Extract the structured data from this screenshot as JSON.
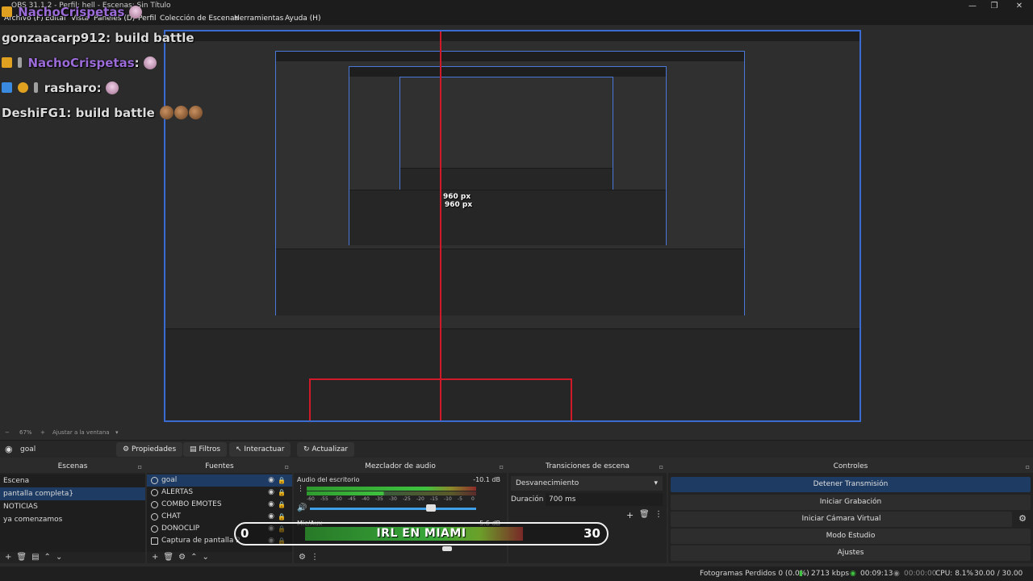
{
  "window": {
    "title": "OBS 31.1.2 - Perfil: hell - Escenas: Sin Título",
    "minimize_glyph": "—",
    "maximize_glyph": "❐",
    "close_glyph": "✕"
  },
  "menu": {
    "items": [
      "Archivo (F)",
      "Editar",
      "Vista",
      "Paneles (D)",
      "Perfil",
      "Colección de Escenas",
      "Herramientas",
      "Ayuda (H)"
    ]
  },
  "chat": {
    "lines": [
      {
        "user": "NachoCrispetas",
        "color": "#9b6bd8",
        "message": ""
      },
      {
        "user": "gonzaacarp912",
        "color": "#e0e0e0",
        "message": ": build battle"
      },
      {
        "user": "NachoCrispetas",
        "color": "#9b6bd8",
        "message": ":"
      },
      {
        "user": "rasharo",
        "color": "#e0e0e0",
        "message": ":"
      },
      {
        "user": "DeshiFG1",
        "color": "#e0e0e0",
        "message": ": build battle"
      }
    ]
  },
  "preview": {
    "nested_px_label": "960 px",
    "nested_px_label_2": "960 px"
  },
  "zoom": {
    "minus": "−",
    "value": "67%",
    "plus": "+",
    "fit": "Ajustar a la ventana"
  },
  "source_toolbar": {
    "current_source": "goal",
    "properties": "Propiedades",
    "filters": "Filtros",
    "interact": "Interactuar",
    "refresh": "Actualizar"
  },
  "scenes": {
    "title": "Escenas",
    "items": [
      "Escena",
      "pantalla completa}",
      "NOTICIAS",
      "ya comenzamos"
    ],
    "active_index": 1
  },
  "sources": {
    "title": "Fuentes",
    "items": [
      "goal",
      "ALERTAS",
      "COMBO EMOTES",
      "CHAT",
      "DONOCLIP",
      "Captura de pantalla 2"
    ],
    "active_index": 0
  },
  "mixer": {
    "title": "Mezclador de audio",
    "channel_1": {
      "name": "Audio del escritorio",
      "level": "-10.1 dB"
    },
    "channel_2": {
      "name": "Mic/Aux",
      "level": "-5.6 dB"
    },
    "scale": [
      "-60",
      "-55",
      "-50",
      "-45",
      "-40",
      "-35",
      "-30",
      "-25",
      "-20",
      "-15",
      "-10",
      "-5",
      "0"
    ]
  },
  "transitions": {
    "title": "Transiciones de escena",
    "type": "Desvanecimiento",
    "duration_label": "Duración",
    "duration_value": "700 ms"
  },
  "controls": {
    "title": "Controles",
    "buttons": [
      "Detener Transmisión",
      "Iniciar Grabación",
      "Iniciar Cámara Virtual",
      "Modo Estudio",
      "Ajustes"
    ]
  },
  "overlay": {
    "left_number": "0",
    "title": "IRL EN MIAMI",
    "right_number": "30"
  },
  "status": {
    "dropped": "Fotogramas Perdidos 0 (0.0%)",
    "bitrate": "2713 kbps",
    "stream_time": "00:09:13",
    "rec_time": "00:00:00",
    "cpu": "CPU: 8.1%",
    "fps": "30.00 / 30.00 FPS"
  },
  "colors": {
    "accent": "#3a6bd0",
    "selection": "#1d3b63",
    "guide_red": "#d01a2a",
    "meter_green": "#3fc23f",
    "meter_yellow": "#c8c83a",
    "meter_red": "#c83a3a"
  }
}
